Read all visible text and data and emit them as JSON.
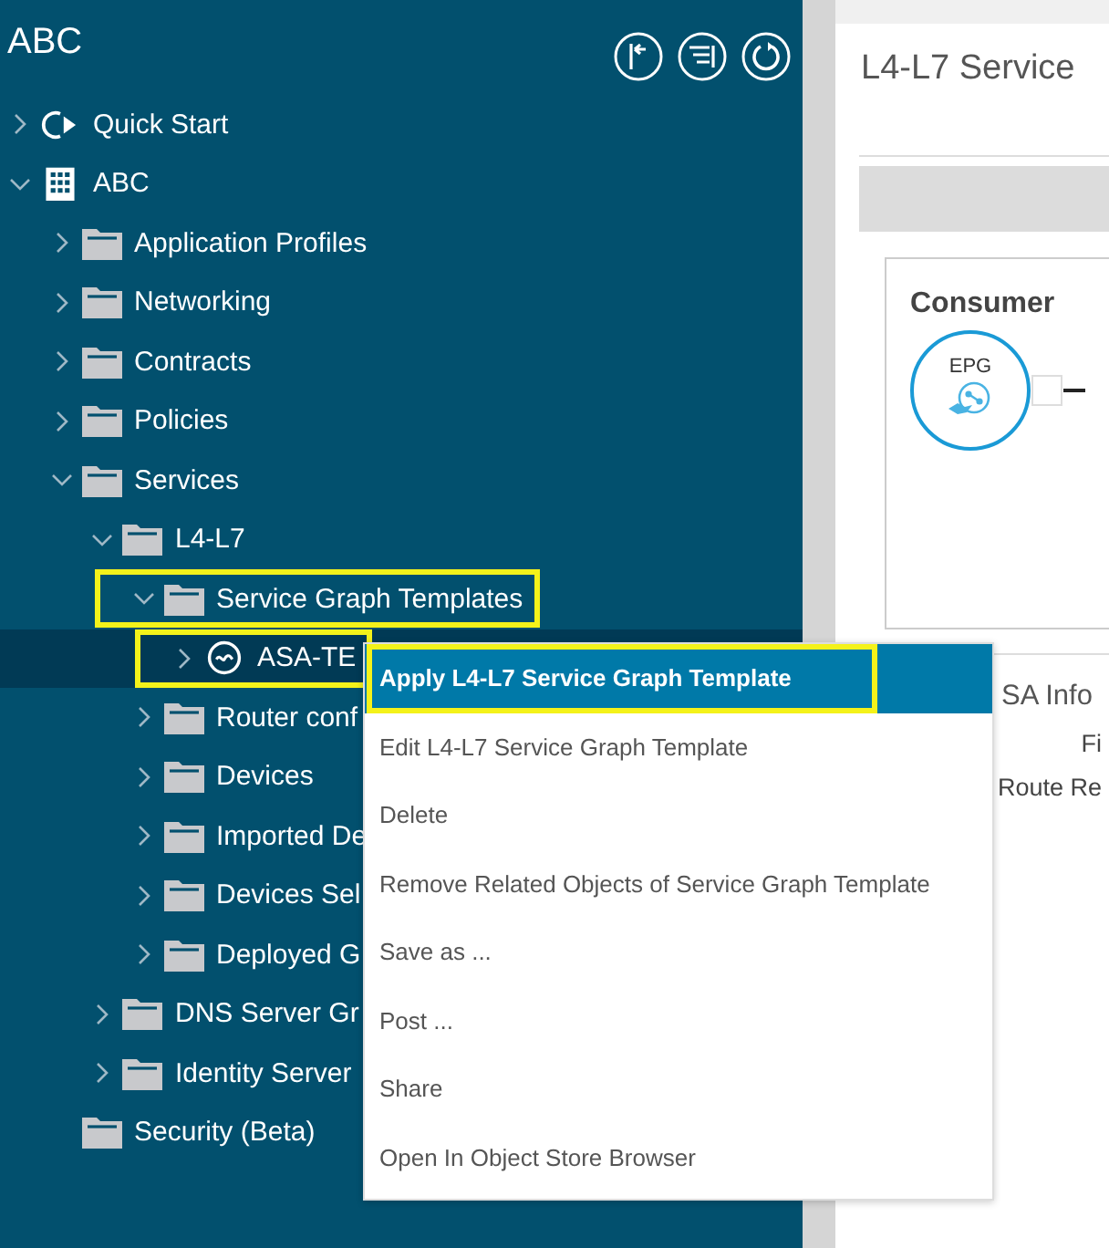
{
  "sidebar": {
    "title": "ABC",
    "tools": [
      {
        "kind": "pin"
      },
      {
        "kind": "collapse"
      },
      {
        "kind": "refresh"
      }
    ],
    "tree": [
      {
        "label": "Quick Start",
        "kind": "quickstart",
        "expanded": false,
        "selected": false,
        "highlighted": false
      },
      {
        "label": "ABC",
        "kind": "tenant",
        "expanded": true,
        "selected": false,
        "highlighted": false,
        "children": [
          {
            "label": "Application Profiles",
            "kind": "folder",
            "expanded": false,
            "selected": false,
            "highlighted": false
          },
          {
            "label": "Networking",
            "kind": "folder",
            "expanded": false,
            "selected": false,
            "highlighted": false
          },
          {
            "label": "Contracts",
            "kind": "folder",
            "expanded": false,
            "selected": false,
            "highlighted": false
          },
          {
            "label": "Policies",
            "kind": "folder",
            "expanded": false,
            "selected": false,
            "highlighted": false
          },
          {
            "label": "Services",
            "kind": "folder",
            "expanded": true,
            "selected": false,
            "highlighted": false,
            "children": [
              {
                "label": "L4-L7",
                "kind": "folder",
                "expanded": true,
                "selected": false,
                "highlighted": false,
                "children": [
                  {
                    "label": "Service Graph Templates",
                    "kind": "folder",
                    "expanded": true,
                    "selected": false,
                    "highlighted": true,
                    "children": [
                      {
                        "label": "ASA-TE",
                        "kind": "graph",
                        "expanded": false,
                        "selected": true,
                        "highlighted": true
                      }
                    ]
                  },
                  {
                    "label": "Router conf",
                    "kind": "folder",
                    "expanded": false,
                    "selected": false,
                    "highlighted": false
                  },
                  {
                    "label": "Devices",
                    "kind": "folder",
                    "expanded": false,
                    "selected": false,
                    "highlighted": false
                  },
                  {
                    "label": "Imported De",
                    "kind": "folder",
                    "expanded": false,
                    "selected": false,
                    "highlighted": false
                  },
                  {
                    "label": "Devices Sel",
                    "kind": "folder",
                    "expanded": false,
                    "selected": false,
                    "highlighted": false
                  },
                  {
                    "label": "Deployed G",
                    "kind": "folder",
                    "expanded": false,
                    "selected": false,
                    "highlighted": false
                  }
                ]
              },
              {
                "label": "DNS Server Gr",
                "kind": "folder",
                "expanded": false,
                "selected": false,
                "highlighted": false
              },
              {
                "label": "Identity Server",
                "kind": "folder",
                "expanded": false,
                "selected": false,
                "highlighted": false
              }
            ]
          },
          {
            "label": "Security (Beta)",
            "kind": "folder",
            "selected": false,
            "highlighted": false
          }
        ]
      }
    ]
  },
  "context_menu": [
    {
      "label": "Apply L4-L7 Service Graph Template",
      "selected": true,
      "highlighted": true
    },
    {
      "label": "Edit L4-L7 Service Graph Template",
      "selected": false,
      "highlighted": false
    },
    {
      "label": "Delete",
      "selected": false,
      "highlighted": false
    },
    {
      "label": "Remove Related Objects of Service Graph Template",
      "selected": false,
      "highlighted": false
    },
    {
      "label": "Save as ...",
      "selected": false,
      "highlighted": false
    },
    {
      "label": "Post ...",
      "selected": false,
      "highlighted": false
    },
    {
      "label": "Share",
      "selected": false,
      "highlighted": false
    },
    {
      "label": "Open In Object Store Browser",
      "selected": false,
      "highlighted": false
    }
  ],
  "content": {
    "title": "L4-L7 Service",
    "card": {
      "title": "Consumer",
      "node": "EPG"
    },
    "info": [
      {
        "kind": "heading",
        "text": "SA Info"
      },
      {
        "kind": "label",
        "text": "Fi"
      },
      {
        "kind": "label",
        "text": "Route Re"
      }
    ]
  }
}
